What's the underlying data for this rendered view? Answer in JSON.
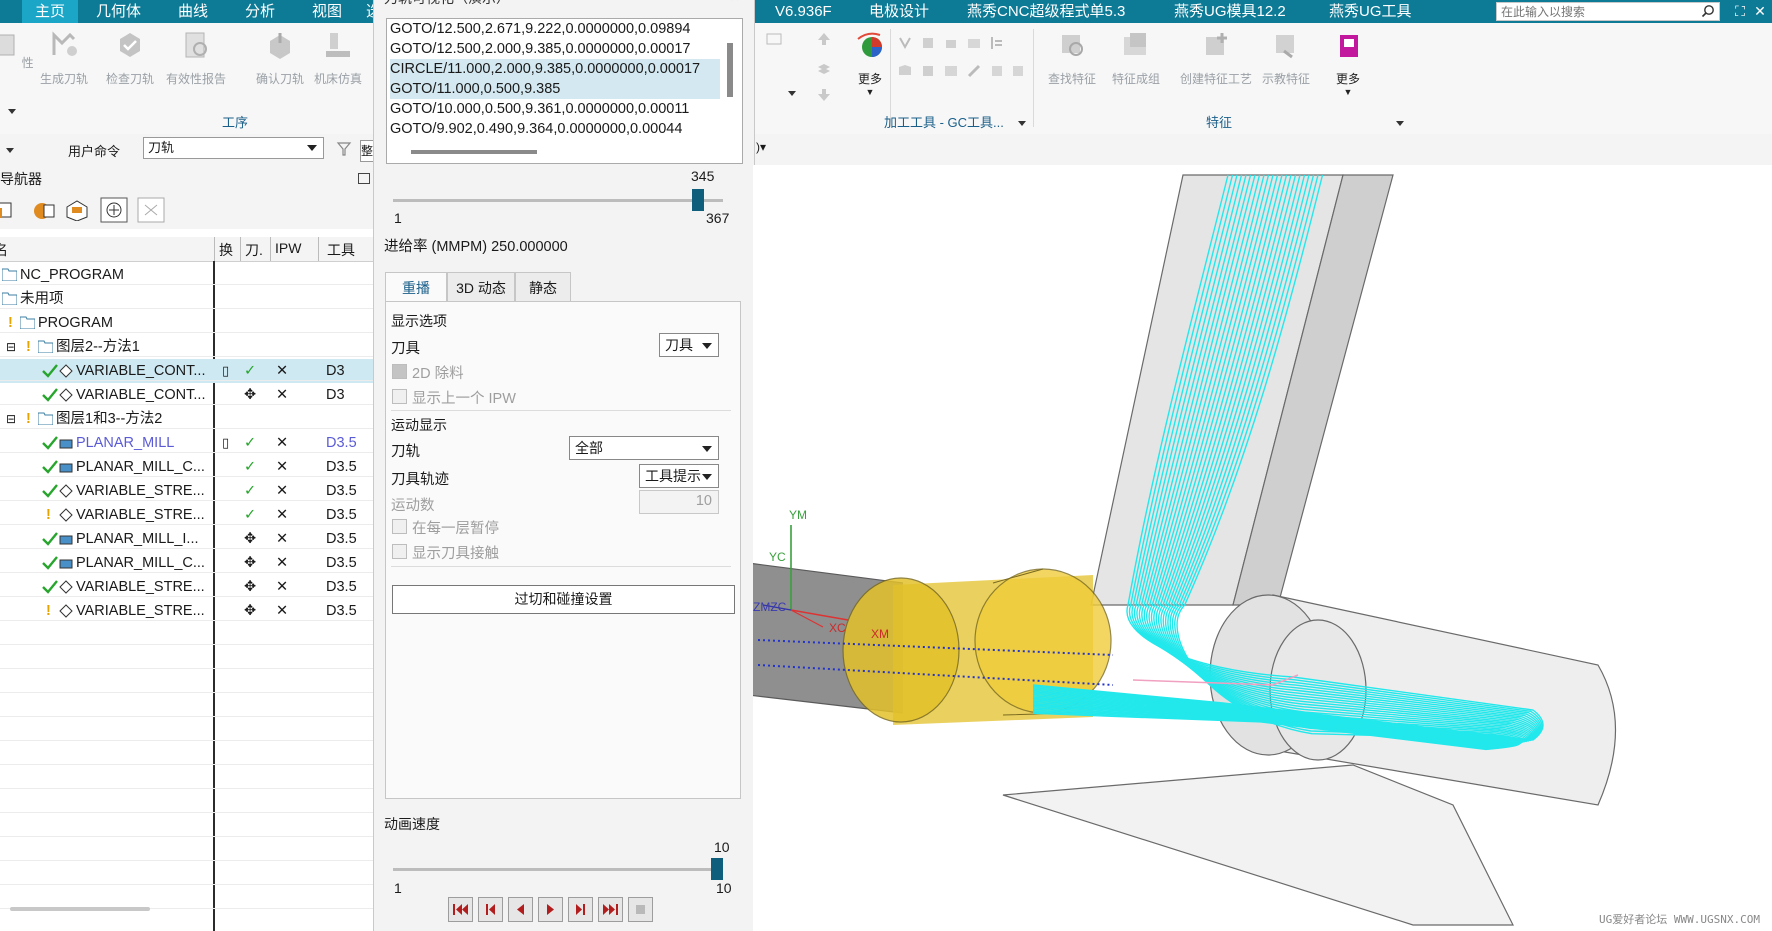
{
  "menubar": {
    "items": [
      "主页",
      "几何体",
      "曲线",
      "分析",
      "视图",
      "选",
      "V6.936F",
      "电极设计",
      "燕秀CNC超级程式单5.3",
      "燕秀UG模具12.2",
      "燕秀UG工具"
    ],
    "search_placeholder": "在此输入以搜索"
  },
  "ribbon": {
    "left_cut_label": "性",
    "ops_buttons": [
      "生成刀轨",
      "检查刀轨",
      "有效性报告",
      "确认刀轨",
      "机床仿真"
    ],
    "ops_group_label": "工序",
    "more_label": "更多",
    "tools_group_label": "加工工具 - GC工具...",
    "feature_buttons": [
      "查找特征",
      "特征成组",
      "创建特征工艺",
      "示教特征"
    ],
    "feature_more_label": "更多",
    "feature_group_label": "特征"
  },
  "cmdbar": {
    "user_cmd_label": "用户命令",
    "dropdown_value": "刀轨",
    "cut_char": "整"
  },
  "navigator": {
    "title": "序导航器",
    "headers": [
      "名",
      "换",
      "刀.",
      "IPW",
      "工具"
    ],
    "rows": [
      {
        "name": "NC_PROGRAM",
        "tool": ""
      },
      {
        "name": "未用项",
        "tool": ""
      },
      {
        "name": "PROGRAM",
        "tool": ""
      },
      {
        "name": "图层2--方法1",
        "tool": ""
      },
      {
        "name": "VARIABLE_CONT...",
        "tool": "D3"
      },
      {
        "name": "VARIABLE_CONT...",
        "tool": "D3"
      },
      {
        "name": "图层1和3--方法2",
        "tool": ""
      },
      {
        "name": "PLANAR_MILL",
        "tool": "D3.5"
      },
      {
        "name": "PLANAR_MILL_C...",
        "tool": "D3.5"
      },
      {
        "name": "VARIABLE_STRE...",
        "tool": "D3.5"
      },
      {
        "name": "VARIABLE_STRE...",
        "tool": "D3.5"
      },
      {
        "name": "PLANAR_MILL_I...",
        "tool": "D3.5"
      },
      {
        "name": "PLANAR_MILL_C...",
        "tool": "D3.5"
      },
      {
        "name": "VARIABLE_STRE...",
        "tool": "D3.5"
      },
      {
        "name": "VARIABLE_STRE...",
        "tool": "D3.5"
      }
    ]
  },
  "dialog": {
    "title": "刀轨可视化（演示）",
    "cl_lines": [
      "GOTO/12.500,2.671,9.222,0.0000000,0.09894",
      "GOTO/12.500,2.000,9.385,0.0000000,0.00017",
      "CIRCLE/11.000,2.000,9.385,0.0000000,0.00017",
      "GOTO/11.000,0.500,9.385",
      "GOTO/10.000,0.500,9.361,0.0000000,0.00011",
      "GOTO/9.902,0.490,9.364,0.0000000,0.00044"
    ],
    "position": {
      "current": 345,
      "min": "1",
      "max": "367"
    },
    "feed_rate": "进给率 (MMPM) 250.000000",
    "tabs": [
      "重播",
      "3D 动态",
      "静态"
    ],
    "display_options": {
      "title": "显示选项",
      "tool_label": "刀具",
      "tool_value": "刀具",
      "remove_2d": "2D 除料",
      "show_prev_ipw": "显示上一个 IPW"
    },
    "motion_display": {
      "title": "运动显示",
      "path_label": "刀轨",
      "path_value": "全部",
      "trace_label": "刀具轨迹",
      "trace_value": "工具提示",
      "count_label": "运动数",
      "count_value": "10",
      "pause_each_layer": "在每一层暂停",
      "show_contact": "显示刀具接触"
    },
    "overcut_button": "过切和碰撞设置",
    "anim_speed": {
      "label": "动画速度",
      "current": 10,
      "min": "1",
      "max": "10"
    }
  },
  "viewport": {
    "axis_labels": {
      "ym": "YM",
      "yc": "YC",
      "zm": "ZMZC",
      "xc": "XC",
      "xm": "XM"
    },
    "watermark": "UG爱好者论坛 WWW.UGSNX.COM",
    "colors": {
      "toolpath": "#22e8ec",
      "stock": "#e3c12a",
      "part": "#d4d4d4"
    }
  }
}
